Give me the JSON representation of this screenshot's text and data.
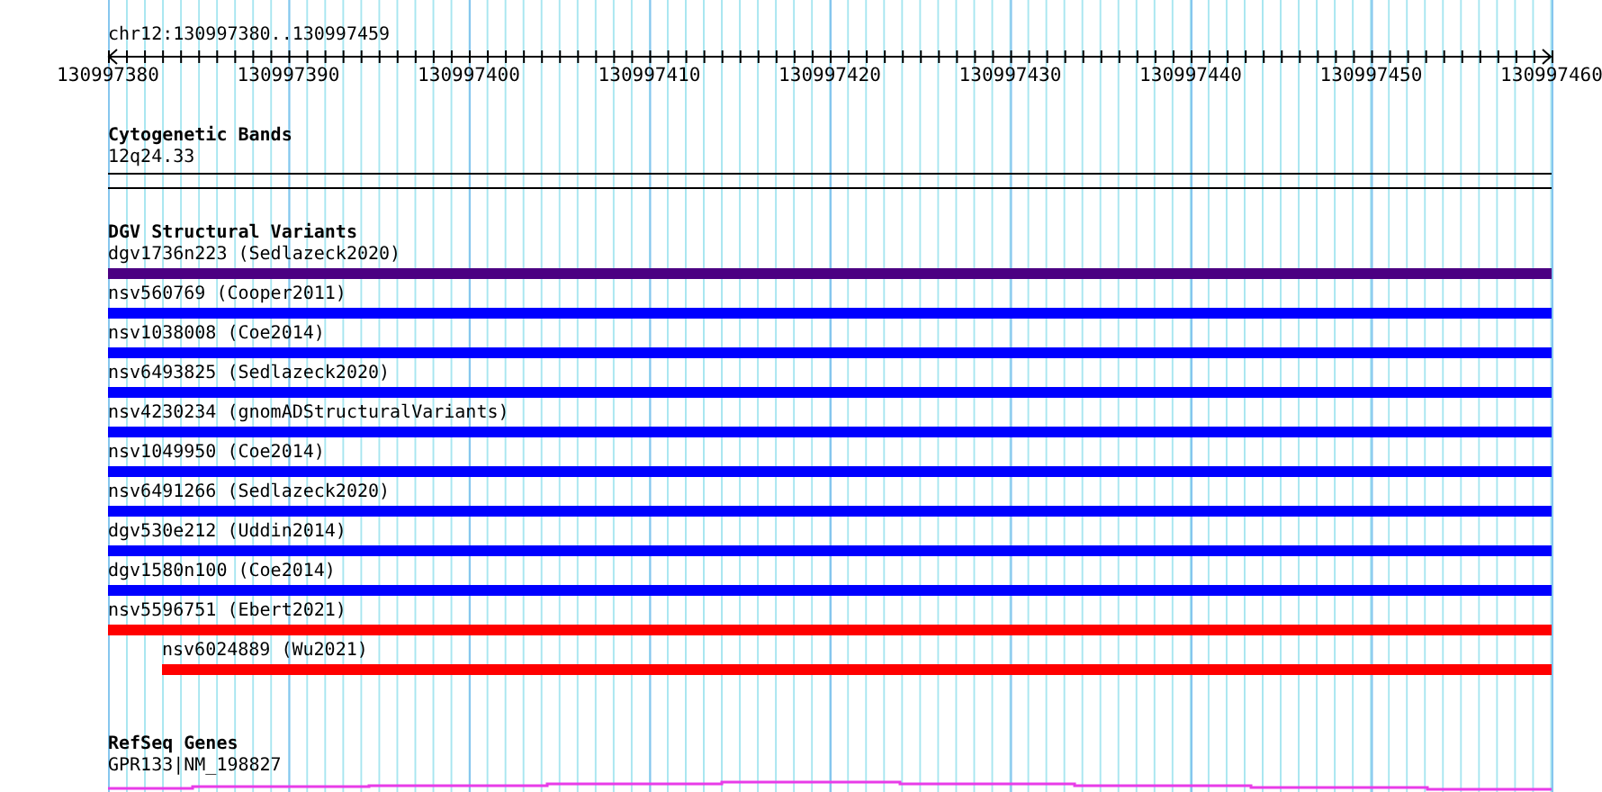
{
  "ruler": {
    "location": "chr12:130997380..130997459",
    "labels": [
      "130997380",
      "130997390",
      "130997400",
      "130997410",
      "130997420",
      "130997430",
      "130997440",
      "130997450",
      "130997460"
    ]
  },
  "tracks": [
    {
      "kind": "bands",
      "title": "Cytogenetic Bands",
      "items": [
        {
          "label": "12q24.33"
        }
      ]
    },
    {
      "kind": "variants",
      "title": "DGV Structural Variants",
      "items": [
        {
          "label": "dgv1736n223 (Sedlazeck2020)",
          "color": "#4b0082",
          "kind": "full"
        },
        {
          "label": "nsv560769 (Cooper2011)",
          "color": "#0000ff",
          "kind": "full"
        },
        {
          "label": "nsv1038008 (Coe2014)",
          "color": "#0000ff",
          "kind": "full"
        },
        {
          "label": "nsv6493825 (Sedlazeck2020)",
          "color": "#0000ff",
          "kind": "full"
        },
        {
          "label": "nsv4230234 (gnomADStructuralVariants)",
          "color": "#0000ff",
          "kind": "full"
        },
        {
          "label": "nsv1049950 (Coe2014)",
          "color": "#0000ff",
          "kind": "full"
        },
        {
          "label": "nsv6491266 (Sedlazeck2020)",
          "color": "#0000ff",
          "kind": "full"
        },
        {
          "label": "dgv530e212 (Uddin2014)",
          "color": "#0000ff",
          "kind": "full"
        },
        {
          "label": "dgv1580n100 (Coe2014)",
          "color": "#0000ff",
          "kind": "full"
        },
        {
          "label": "nsv5596751 (Ebert2021)",
          "color": "#ff0000",
          "kind": "full"
        },
        {
          "label": "nsv6024889 (Wu2021)",
          "color": "#ff0000",
          "kind": "inset"
        }
      ]
    },
    {
      "kind": "genes",
      "title": "RefSeq Genes",
      "items": [
        {
          "label": "GPR133|NM_198827"
        }
      ]
    }
  ]
}
